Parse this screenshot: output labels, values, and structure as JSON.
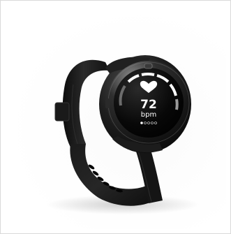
{
  "image": {
    "subject": "watch-product-photo",
    "background_color": "#ffffff",
    "watch_color": "#141414"
  },
  "watch_face": {
    "icon": "heart-icon",
    "heart_rate_value": "72",
    "heart_rate_unit": "bpm",
    "page_indicator": {
      "total": 5,
      "active": 1
    },
    "colors": {
      "screen": "#000000",
      "gauge_active": "#ffffff",
      "gauge_inactive": "#6c6c6c"
    }
  }
}
